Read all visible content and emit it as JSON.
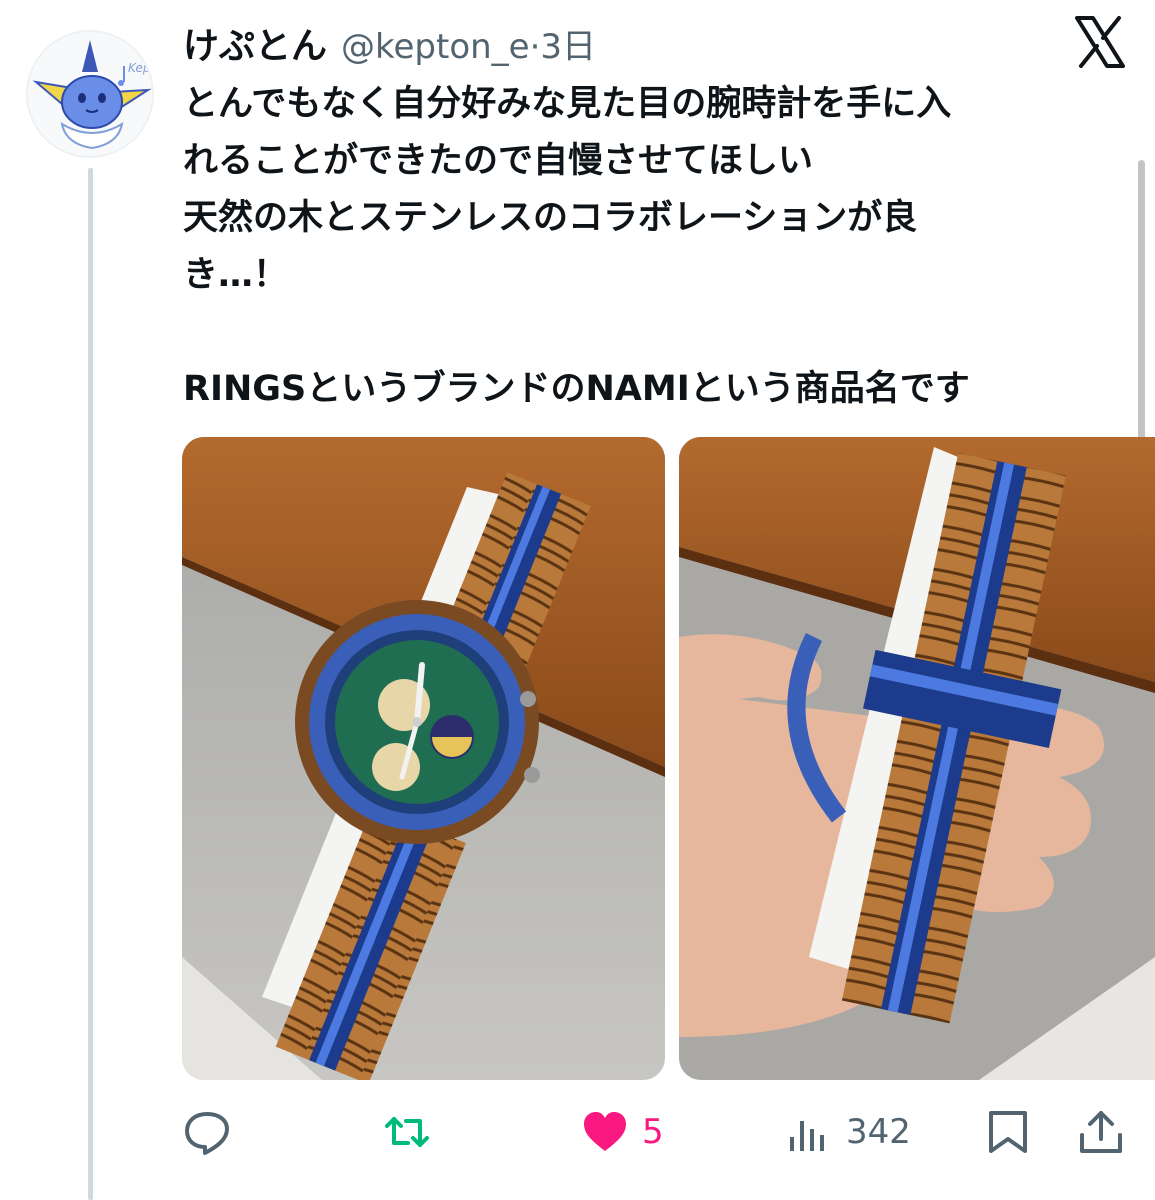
{
  "tweet": {
    "display_name": "けぷとん",
    "handle": "@kepton_e",
    "separator": "·",
    "time": "3日",
    "text_lines": [
      "とんでもなく自分好みな見た目の腕時計を手に入",
      "れることができたので自慢させてほしい",
      "天然の木とステンレスのコラボレーションが良",
      "き…！",
      "",
      "RINGSというブランドのNAMIという商品名です"
    ],
    "photos": [
      {
        "icon": "wooden-watch-photo-dial"
      },
      {
        "icon": "wooden-watch-photo-band"
      }
    ]
  },
  "actions": {
    "reply": {
      "icon": "reply-icon",
      "count": ""
    },
    "retweet": {
      "icon": "retweet-icon",
      "count": ""
    },
    "like": {
      "icon": "heart-icon",
      "count": "5",
      "liked": true
    },
    "views": {
      "icon": "views-icon",
      "count": "342"
    },
    "bookmark": {
      "icon": "bookmark-icon"
    },
    "share": {
      "icon": "share-icon"
    }
  },
  "colors": {
    "text": "#0f1419",
    "secondary": "#536471",
    "retweet": "#00ba7c",
    "like": "#f91880",
    "thread_line": "#cfd9de"
  }
}
